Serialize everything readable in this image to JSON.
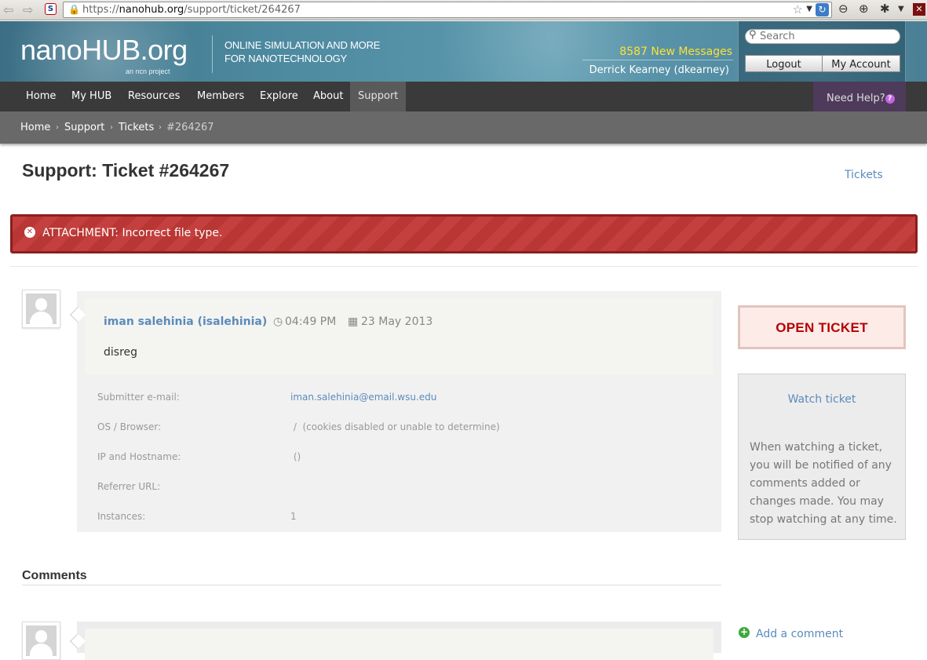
{
  "browser": {
    "url_prefix": "https://",
    "url_host": "nanohub.org",
    "url_path": "/support/ticket/264267",
    "site_icon_text": "S"
  },
  "header": {
    "logo": "nanoHUB.org",
    "logo_sub": "an ncn project",
    "tagline": "Online Simulation and More for Nanotechnology",
    "new_messages": "8587 New Messages",
    "user_name": "Derrick Kearney (dkearney)",
    "search_placeholder": "Search",
    "logout": "Logout",
    "my_account": "My Account"
  },
  "nav": {
    "items": [
      "Home",
      "My HUB",
      "Resources",
      "Members",
      "Explore",
      "About",
      "Support"
    ],
    "active": "Support",
    "need_help": "Need Help?"
  },
  "breadcrumbs": [
    "Home",
    "Support",
    "Tickets",
    "#264267"
  ],
  "page": {
    "title": "Support: Ticket #264267",
    "tickets_link": "Tickets"
  },
  "error": {
    "message": "ATTACHMENT: Incorrect file type."
  },
  "ticket": {
    "author": "iman salehinia (isalehinia)",
    "time": "04:49 PM",
    "date": "23 May 2013",
    "text": "disreg",
    "details": [
      {
        "label": "Submitter e-mail:",
        "value": "iman.salehinia@email.wsu.edu",
        "link": true
      },
      {
        "label": "OS / Browser:",
        "value": " /  (cookies disabled or unable to determine)",
        "link": false
      },
      {
        "label": "IP and Hostname:",
        "value": " ()",
        "link": false
      },
      {
        "label": "Referrer URL:",
        "value": "",
        "link": false
      },
      {
        "label": "Instances:",
        "value": "1",
        "link": false
      }
    ]
  },
  "sidebar": {
    "status": "OPEN TICKET",
    "watch_link": "Watch ticket",
    "watch_desc": "When watching a ticket, you will be notified of any comments added or changes made. You may stop watching at any time."
  },
  "comments": {
    "title": "Comments",
    "add_comment": "Add a comment"
  },
  "colors": {
    "link": "#5b8bbd",
    "nav_bg": "#3a3a3a",
    "error_bg": "#c4403e",
    "status_text": "#b40000",
    "messages": "#ffe033"
  }
}
